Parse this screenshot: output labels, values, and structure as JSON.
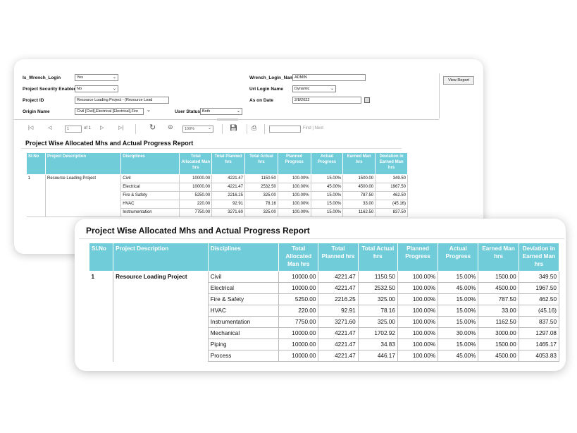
{
  "params": {
    "is_wrench_login": {
      "label": "Is_Wrench_Login",
      "value": "Yes"
    },
    "project_security": {
      "label": "Project Security Enabled",
      "value": "No"
    },
    "project_id": {
      "label": "Project ID",
      "value": "Resource Loading Project - (Resource Load"
    },
    "origin_name": {
      "label": "Origin Name",
      "value": "Civil [Civil],Electrical [Electrical],Fire"
    },
    "user_status": {
      "label": "User Status",
      "value": "Both"
    },
    "wrench_login_name": {
      "label": "Wrench_Login_Name",
      "value": "ADMIN"
    },
    "url_login_name": {
      "label": "Url Login Name",
      "value": "Dynamic"
    },
    "as_on_date": {
      "label": "As on Date",
      "value": "2/8/2022"
    },
    "view_report": "View Report"
  },
  "toolbar": {
    "first": "|◁",
    "prev": "◁",
    "page": "1",
    "of": "of 1",
    "next": "▷",
    "last": "▷|",
    "refresh": "↻",
    "back": "⊝",
    "zoom": "100%",
    "find_next": "Find | Next"
  },
  "report": {
    "title": "Project Wise Allocated Mhs and Actual Progress Report",
    "headers": [
      "Sl.No",
      "Project Description",
      "Disciplines",
      "Total Allocated Man hrs",
      "Total Planned hrs",
      "Total Actual hrs",
      "Planned Progress",
      "Actual Progress",
      "Earned Man hrs",
      "Deviation in Earned Man hrs"
    ],
    "sl_no": "1",
    "project": "Resource Loading Project",
    "rows": [
      [
        "Civil",
        "10000.00",
        "4221.47",
        "1150.50",
        "100.00%",
        "15.00%",
        "1500.00",
        "349.50"
      ],
      [
        "Electrical",
        "10000.00",
        "4221.47",
        "2532.50",
        "100.00%",
        "45.00%",
        "4500.00",
        "1967.50"
      ],
      [
        "Fire & Safety",
        "5250.00",
        "2216.25",
        "325.00",
        "100.00%",
        "15.00%",
        "787.50",
        "462.50"
      ],
      [
        "HVAC",
        "220.00",
        "92.91",
        "78.16",
        "100.00%",
        "15.00%",
        "33.00",
        "(45.16)"
      ],
      [
        "Instrumentation",
        "7750.00",
        "3271.60",
        "325.00",
        "100.00%",
        "15.00%",
        "1162.50",
        "837.50"
      ],
      [
        "Mechanical",
        "10000.00",
        "4221.47",
        "1702.92",
        "100.00%",
        "30.00%",
        "3000.00",
        "1297.08"
      ],
      [
        "Piping",
        "10000.00",
        "4221.47",
        "34.83",
        "100.00%",
        "15.00%",
        "1500.00",
        "1465.17"
      ],
      [
        "Process",
        "10000.00",
        "4221.47",
        "446.17",
        "100.00%",
        "45.00%",
        "4500.00",
        "4053.83"
      ]
    ]
  },
  "colors": {
    "header_bg": "#71ccd9"
  }
}
